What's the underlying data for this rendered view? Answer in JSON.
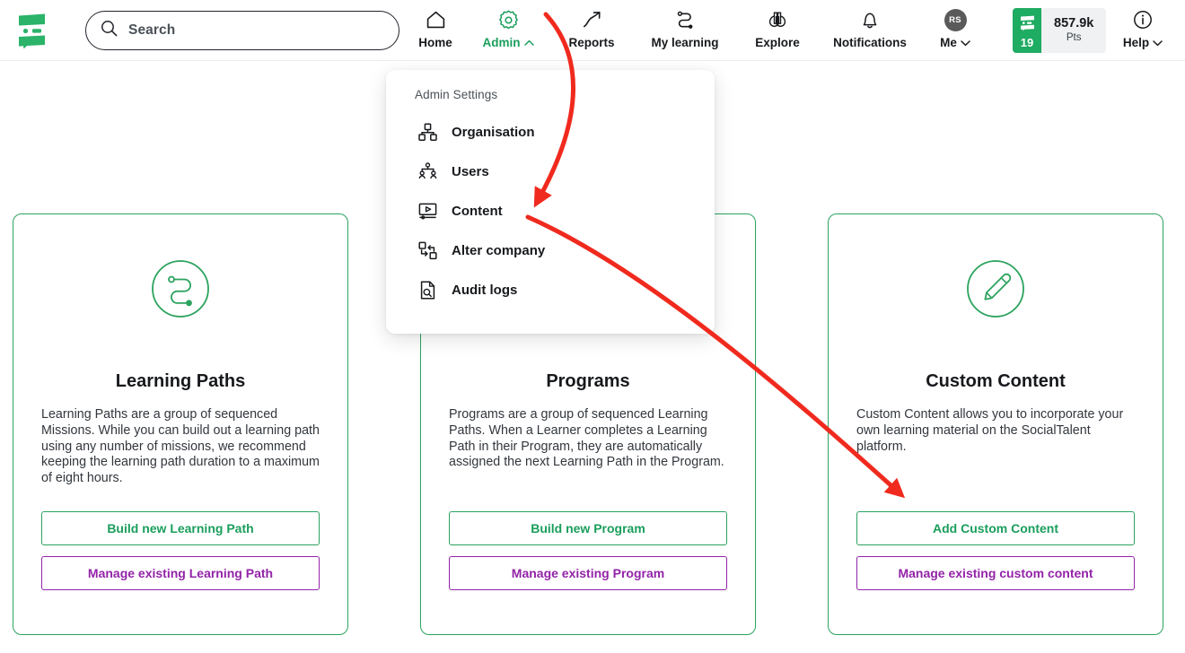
{
  "brand": {
    "logo_icon": "socialtalent-logo-icon",
    "green": "#1a9e5c",
    "purple": "#9323a8",
    "annotation_red": "#f02a1e"
  },
  "search": {
    "icon": "search-icon",
    "placeholder": "Search",
    "value": ""
  },
  "nav": {
    "items": [
      {
        "label": "Home",
        "icon": "home-icon",
        "active": false,
        "chevron": ""
      },
      {
        "label": "Admin",
        "icon": "gear-icon",
        "active": true,
        "chevron": "chevron-up-icon"
      },
      {
        "label": "Reports",
        "icon": "trending-up-arrow-icon",
        "active": false,
        "chevron": ""
      },
      {
        "label": "My learning",
        "icon": "winding-path-icon",
        "active": false,
        "chevron": ""
      },
      {
        "label": "Explore",
        "icon": "binoculars-icon",
        "active": false,
        "chevron": ""
      },
      {
        "label": "Notifications",
        "icon": "bell-icon",
        "active": false,
        "chevron": ""
      },
      {
        "label": "Me",
        "icon": "avatar-icon",
        "active": false,
        "chevron": "chevron-down-icon"
      }
    ],
    "me_avatar_initials": "RS",
    "help": {
      "label": "Help",
      "icon": "info-circle-icon",
      "chevron": "chevron-down-icon"
    }
  },
  "points_badge": {
    "level": "19",
    "value": "857.9k",
    "unit": "Pts",
    "icon": "socialtalent-logo-icon"
  },
  "admin_dropdown": {
    "title": "Admin Settings",
    "items": [
      {
        "label": "Organisation",
        "icon": "org-chart-icon"
      },
      {
        "label": "Users",
        "icon": "users-hierarchy-icon"
      },
      {
        "label": "Content",
        "icon": "media-player-icon"
      },
      {
        "label": "Alter company",
        "icon": "swap-boxes-icon"
      },
      {
        "label": "Audit logs",
        "icon": "document-search-icon"
      }
    ]
  },
  "cards": [
    {
      "icon": "learning-path-circle-icon",
      "title": "Learning Paths",
      "description": "Learning Paths are a group of sequenced Missions. While you can build out a learning path using any number of missions, we recommend keeping the learning path duration to a maximum of eight hours.",
      "primary_button": "Build new Learning Path",
      "secondary_button": "Manage existing Learning Path"
    },
    {
      "icon": "programs-circle-icon",
      "title": "Programs",
      "description": "Programs are a group of sequenced Learning Paths. When a Learner completes a Learning Path in their Program, they are automatically assigned the next Learning Path in the Program.",
      "primary_button": "Build new Program",
      "secondary_button": "Manage existing Program"
    },
    {
      "icon": "pencil-circle-icon",
      "title": "Custom Content",
      "description": "Custom Content allows you to incorporate your own learning material on the SocialTalent platform.",
      "primary_button": "Add Custom Content",
      "secondary_button": "Manage existing custom content"
    }
  ],
  "annotations": [
    {
      "name": "arrow-admin-to-content",
      "from": "Admin nav item",
      "to": "Content menu item"
    },
    {
      "name": "arrow-content-to-add-custom-content",
      "from": "Content menu item",
      "to": "Add Custom Content button"
    }
  ]
}
